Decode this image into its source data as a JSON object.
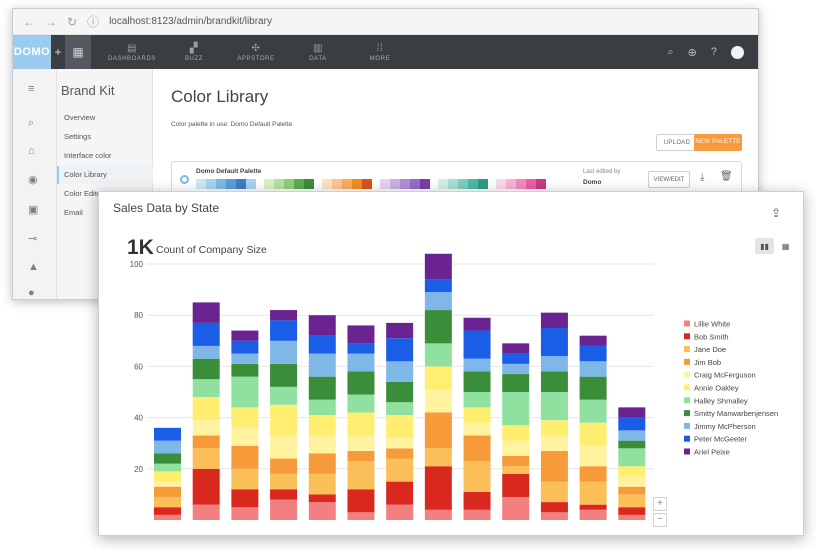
{
  "browser": {
    "url": "localhost:8123/admin/brandkit/library",
    "nav_back": "←",
    "nav_forward": "→",
    "nav_reload": "↻"
  },
  "topnav": {
    "logo": "DOMO",
    "items": [
      {
        "label": "DASHBOARDS",
        "icon": "dashboard-icon"
      },
      {
        "label": "BUZZ",
        "icon": "chat-icon"
      },
      {
        "label": "APPSTORE",
        "icon": "store-icon"
      },
      {
        "label": "DATA",
        "icon": "database-icon"
      },
      {
        "label": "MORE",
        "icon": "grid-icon"
      }
    ]
  },
  "brandkit": {
    "title": "Brand Kit",
    "nav": [
      "Overview",
      "Settings",
      "Interface color",
      "Color Library",
      "Color Editor",
      "Email"
    ],
    "active_index": 3
  },
  "library": {
    "title": "Color Library",
    "palette_note": "Color palette in use: Domo Default Palette",
    "upload_label": "UPLOAD",
    "new_palette_label": "NEW PALETTE",
    "palette": {
      "name": "Domo Default Palette",
      "last_edited_label": "Last edited by",
      "last_edited_by": "Domo",
      "view_edit_label": "VIEW/EDIT",
      "swatch_groups": [
        [
          "#cfe8f6",
          "#a6d4ef",
          "#7fb8e6",
          "#5a9fd4",
          "#3b7fc4",
          "#a6d4ef"
        ],
        [
          "#d8f0c8",
          "#b7e2a0",
          "#8fd07a",
          "#5cae4e",
          "#3a8e3a"
        ],
        [
          "#fde2c4",
          "#fcc890",
          "#fbad5c",
          "#f28c28",
          "#d9531e"
        ],
        [
          "#e5d5f0",
          "#cbb2e3",
          "#b38ed6",
          "#9a6bc9",
          "#7a3fa8"
        ],
        [
          "#d4f0ea",
          "#a8e0d4",
          "#7dcfbf",
          "#4fb8a4",
          "#2e9b8a"
        ],
        [
          "#fbd8ea",
          "#f7b3d5",
          "#f28cbf",
          "#e85fa5",
          "#c93b86"
        ]
      ]
    }
  },
  "chart": {
    "title": "Sales Data by State",
    "summary_value": "1K",
    "summary_label": "Count of Company Size",
    "zoom_in": "+",
    "zoom_out": "−"
  },
  "chart_data": {
    "type": "bar",
    "stacked": true,
    "title": "Sales Data by State",
    "ylabel": "",
    "xlabel": "",
    "ylim": [
      0,
      100
    ],
    "yticks": [
      20,
      40,
      60,
      80,
      100
    ],
    "grid": true,
    "legend_position": "right",
    "series": [
      {
        "name": "Lillie White",
        "color": "#f28080",
        "values": [
          2,
          6,
          5,
          8,
          7,
          3,
          6,
          4,
          4,
          9,
          3,
          4,
          2
        ]
      },
      {
        "name": "Bob Smith",
        "color": "#d9281e",
        "values": [
          3,
          14,
          7,
          4,
          3,
          9,
          9,
          17,
          7,
          9,
          4,
          2,
          3
        ]
      },
      {
        "name": "Jane Doe",
        "color": "#fbbf5a",
        "values": [
          4,
          8,
          8,
          6,
          8,
          11,
          9,
          7,
          12,
          3,
          8,
          9,
          5
        ]
      },
      {
        "name": "Jim Bob",
        "color": "#f79a3a",
        "values": [
          4,
          5,
          9,
          6,
          8,
          4,
          4,
          14,
          10,
          4,
          12,
          6,
          3
        ]
      },
      {
        "name": "Craig McFerguson",
        "color": "#fff3a0",
        "values": [
          2,
          6,
          7,
          9,
          7,
          6,
          4,
          9,
          5,
          6,
          6,
          8,
          4
        ]
      },
      {
        "name": "Annie Oakley",
        "color": "#ffee70",
        "values": [
          4,
          9,
          8,
          12,
          8,
          9,
          9,
          9,
          6,
          6,
          6,
          9,
          4
        ]
      },
      {
        "name": "Halley Shmalley",
        "color": "#90e0a0",
        "values": [
          3,
          7,
          12,
          7,
          6,
          7,
          5,
          9,
          6,
          13,
          11,
          9,
          7
        ]
      },
      {
        "name": "Smitty Manwarbenjensen",
        "color": "#3a8e3a",
        "values": [
          4,
          8,
          5,
          9,
          9,
          9,
          8,
          13,
          8,
          7,
          8,
          9,
          3
        ]
      },
      {
        "name": "Jimmy McPherson",
        "color": "#7fb8e6",
        "values": [
          5,
          5,
          4,
          9,
          9,
          7,
          8,
          7,
          5,
          4,
          6,
          6,
          4
        ]
      },
      {
        "name": "Peter McGeeter",
        "color": "#1a5ee8",
        "values": [
          5,
          9,
          5,
          8,
          7,
          4,
          9,
          5,
          11,
          4,
          11,
          6,
          5
        ]
      },
      {
        "name": "Ariel Peixe",
        "color": "#6a2390",
        "values": [
          0,
          8,
          4,
          4,
          8,
          7,
          6,
          10,
          5,
          4,
          6,
          4,
          4
        ]
      }
    ]
  }
}
